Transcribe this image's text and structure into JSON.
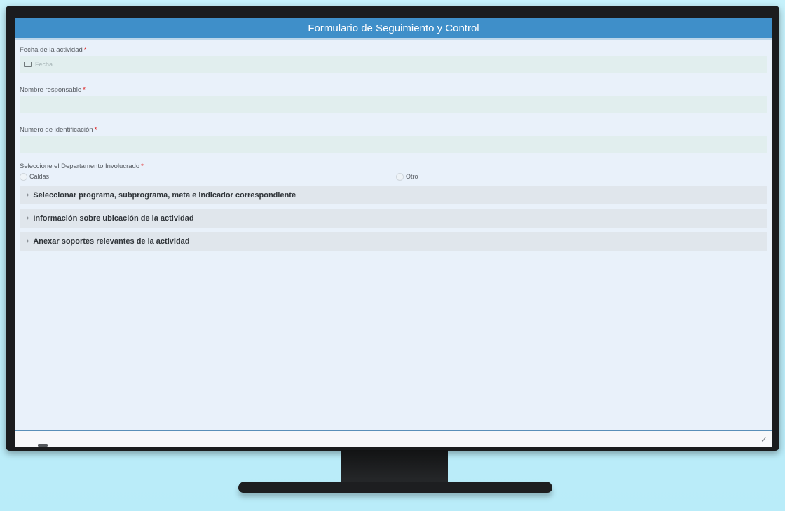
{
  "form": {
    "title": "Formulario de Seguimiento y Control",
    "fields": {
      "fecha": {
        "label": "Fecha de la actividad",
        "placeholder": "Fecha"
      },
      "responsable": {
        "label": "Nombre responsable"
      },
      "identificacion": {
        "label": "Numero de identificación"
      },
      "departamento": {
        "label": "Seleccione el Departamento Involucrado",
        "options": [
          "Caldas",
          "Otro"
        ]
      }
    },
    "required_marker": "*",
    "sections": [
      {
        "label": "Seleccionar programa, subprograma, meta e indicador correspondiente"
      },
      {
        "label": "Información sobre ubicación de la actividad"
      },
      {
        "label": "Anexar soportes relevantes de la actividad"
      }
    ],
    "chevron": "›",
    "submit_icon": "checkmark-icon",
    "calendar_icon": "calendar-icon"
  },
  "colors": {
    "header": "#3f8fc9",
    "required": "#e01c1c",
    "background": "#bfeffb"
  }
}
